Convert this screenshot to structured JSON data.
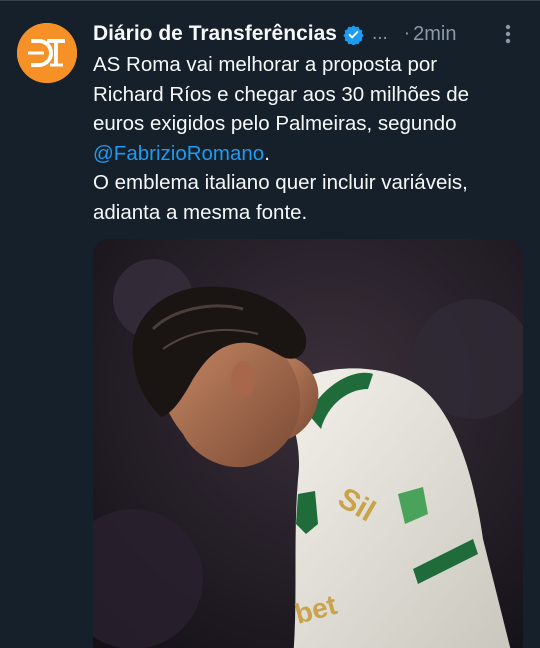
{
  "tweet": {
    "author_name": "Diário de Transferências",
    "avatar_text": "DT",
    "avatar_color": "#f59127",
    "verified_color": "#1d9bf0",
    "ellipsis": "...",
    "separator": "·",
    "time": "2min",
    "more_icon": "more-vertical-icon",
    "text_line1": "AS Roma vai melhorar a proposta por",
    "text_line2": "Richard Ríos e chegar aos 30 milhões de",
    "text_line3": "euros exigidos pelo Palmeiras, segundo",
    "mention": "@FabrizioRomano",
    "mention_suffix": ".",
    "text_line5": "O emblema italiano quer incluir variáveis,",
    "text_line6": "adianta a mesma fonte.",
    "link_color": "#1d9bf0",
    "jersey_sponsor_1": "Sil",
    "jersey_sponsor_2": "bet"
  }
}
